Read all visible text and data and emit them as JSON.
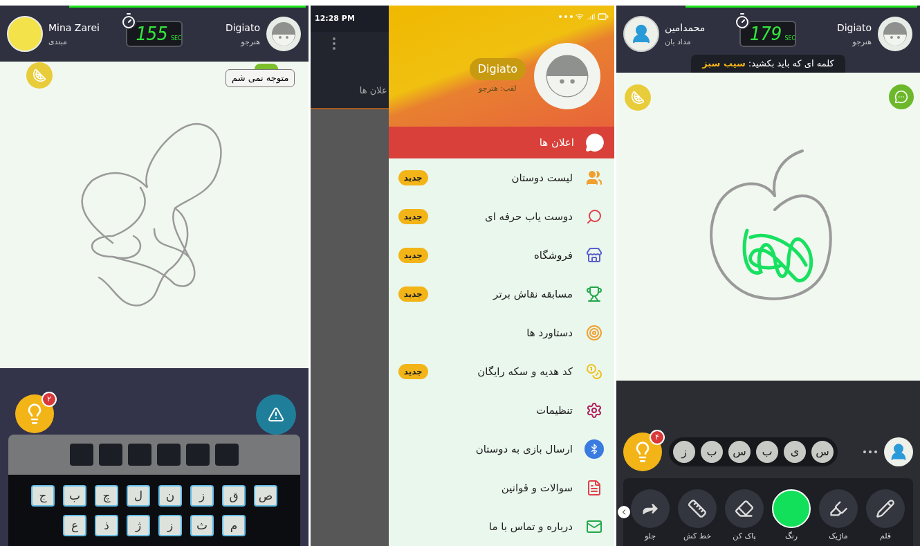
{
  "left_screen": {
    "player": {
      "name": "Mina Zarei",
      "rank": "مبتدی"
    },
    "timer": {
      "value": "155",
      "unit": "SEC"
    },
    "opponent": {
      "name": "Digiato",
      "rank": "هنرجو"
    },
    "chat_bubble": "متوجه نمی شم",
    "hint_badge": "۲",
    "keyboard_rows": [
      [
        "ص",
        "ق",
        "ز",
        "ن",
        "ل",
        "چ",
        "ب",
        "ج"
      ],
      [
        "م",
        "ث",
        "ز",
        "ژ",
        "ذ",
        "ع"
      ]
    ]
  },
  "middle_screen": {
    "status_time": "12:28 PM",
    "background_tab": "علان ها",
    "drawer": {
      "name": "Digiato",
      "nickname": "لقب: هنرجو",
      "header_item": "اعلان ها",
      "items": [
        {
          "label": "لیست دوستان",
          "badge": "جدید"
        },
        {
          "label": "دوست یاب حرفه ای",
          "badge": "جدید"
        },
        {
          "label": "فروشگاه",
          "badge": "جدید"
        },
        {
          "label": "مسابقه نقاش برتر",
          "badge": "جدید"
        },
        {
          "label": "دستاورد ها"
        },
        {
          "label": "کد هدیه و سکه رایگان",
          "badge": "جدید"
        },
        {
          "label": "تنظیمات"
        },
        {
          "label": "ارسال بازی به دوستان"
        },
        {
          "label": "سوالات و قوانین"
        },
        {
          "label": "درباره و تماس با ما"
        }
      ]
    }
  },
  "right_screen": {
    "player": {
      "name": "محمدامین",
      "rank": "مداد بان"
    },
    "timer": {
      "value": "179",
      "unit": "SEC"
    },
    "opponent": {
      "name": "Digiato",
      "rank": "هنرجو"
    },
    "prompt": {
      "label": "کلمه ای که باید بکشید:",
      "word": "سیب سبز"
    },
    "hint_badge": "۴",
    "letters": [
      "س",
      "ی",
      "ب",
      "س",
      "ب",
      "ز"
    ],
    "tools": [
      {
        "label": "قلم",
        "kind": "tool"
      },
      {
        "label": "ماژیک",
        "kind": "tool"
      },
      {
        "label": "رنگ",
        "kind": "swatch",
        "color": "#12e05a"
      },
      {
        "label": "پاک کن",
        "kind": "tool"
      },
      {
        "label": "خط کش",
        "kind": "tool"
      },
      {
        "label": "جلو",
        "kind": "tool"
      }
    ]
  }
}
